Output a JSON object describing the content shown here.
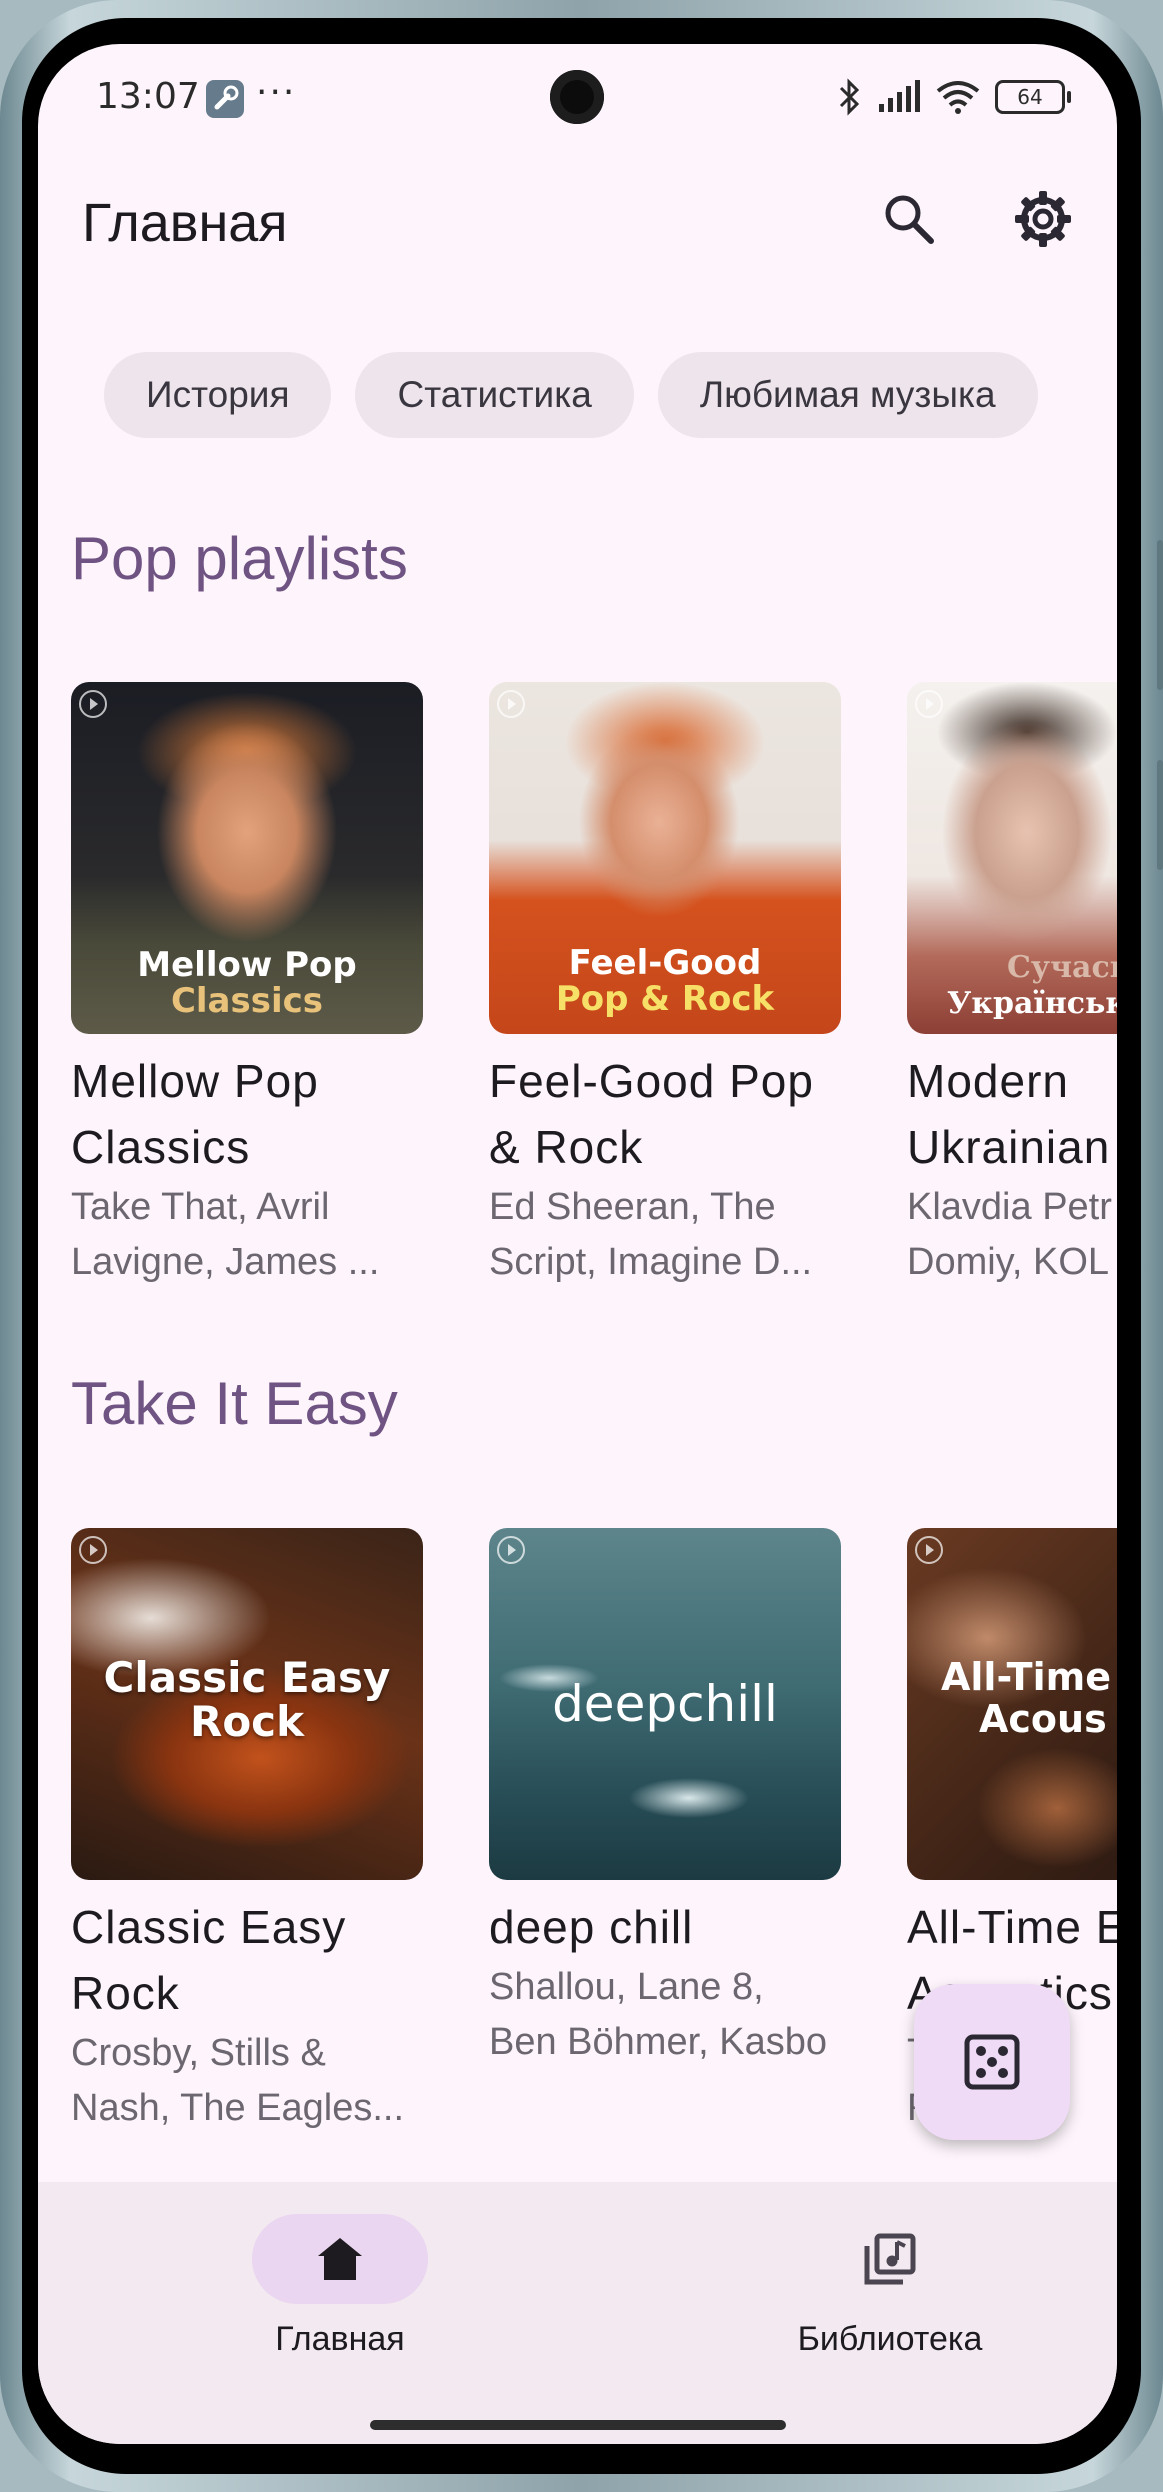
{
  "status_bar": {
    "time": "13:07",
    "dots": "···",
    "battery": "64"
  },
  "header": {
    "title": "Главная",
    "search_icon": "search-icon",
    "settings_icon": "gear-icon"
  },
  "chips": [
    "История",
    "Статистика",
    "Любимая музыка"
  ],
  "sections": [
    {
      "title": "Pop playlists",
      "cards": [
        {
          "overlay_line1": "Mellow Pop",
          "overlay_line2": "Classics",
          "title": "Mellow Pop\nClassics",
          "subtitle_line1": "Take That, Avril",
          "subtitle_line2": "Lavigne, James ..."
        },
        {
          "overlay_line1": "Feel-Good",
          "overlay_line2": "Pop & Rock",
          "title": "Feel-Good Pop\n& Rock",
          "subtitle_line1": "Ed Sheeran, The",
          "subtitle_line2": "Script, Imagine D..."
        },
        {
          "overlay_line1": "Сучасн",
          "overlay_line2": "Українськ",
          "title": "Modern\nUkrainian",
          "subtitle_line1": "Klavdia Petr",
          "subtitle_line2": "Domiy, KOL"
        }
      ]
    },
    {
      "title": "Take It Easy",
      "cards": [
        {
          "overlay_line1": "Classic Easy",
          "overlay_line2": "Rock",
          "title": "Classic Easy\nRock",
          "subtitle_line1": "Crosby, Stills &",
          "subtitle_line2": "Nash, The Eagles..."
        },
        {
          "overlay_line1": "deepchill",
          "overlay_line2": "",
          "title": "deep chill",
          "subtitle_line1": "Shallou, Lane 8,",
          "subtitle_line2": "Ben Böhmer, Kasbo"
        },
        {
          "overlay_line1": "All-Time",
          "overlay_line2": "Acous",
          "title": "All-Time E\nAcoustics",
          "subtitle_line1": "T      les",
          "subtitle_line2": "R      ton"
        }
      ]
    }
  ],
  "fab": {
    "icon": "dice-icon"
  },
  "bottom_nav": [
    {
      "label": "Главная",
      "icon": "home-icon",
      "active": true
    },
    {
      "label": "Библиотека",
      "icon": "library-music-icon",
      "active": false
    }
  ],
  "colors": {
    "accent": "#6f5383",
    "background": "#fdf5fb",
    "chip": "#ede4ec",
    "nav_active": "#ead6f0"
  }
}
